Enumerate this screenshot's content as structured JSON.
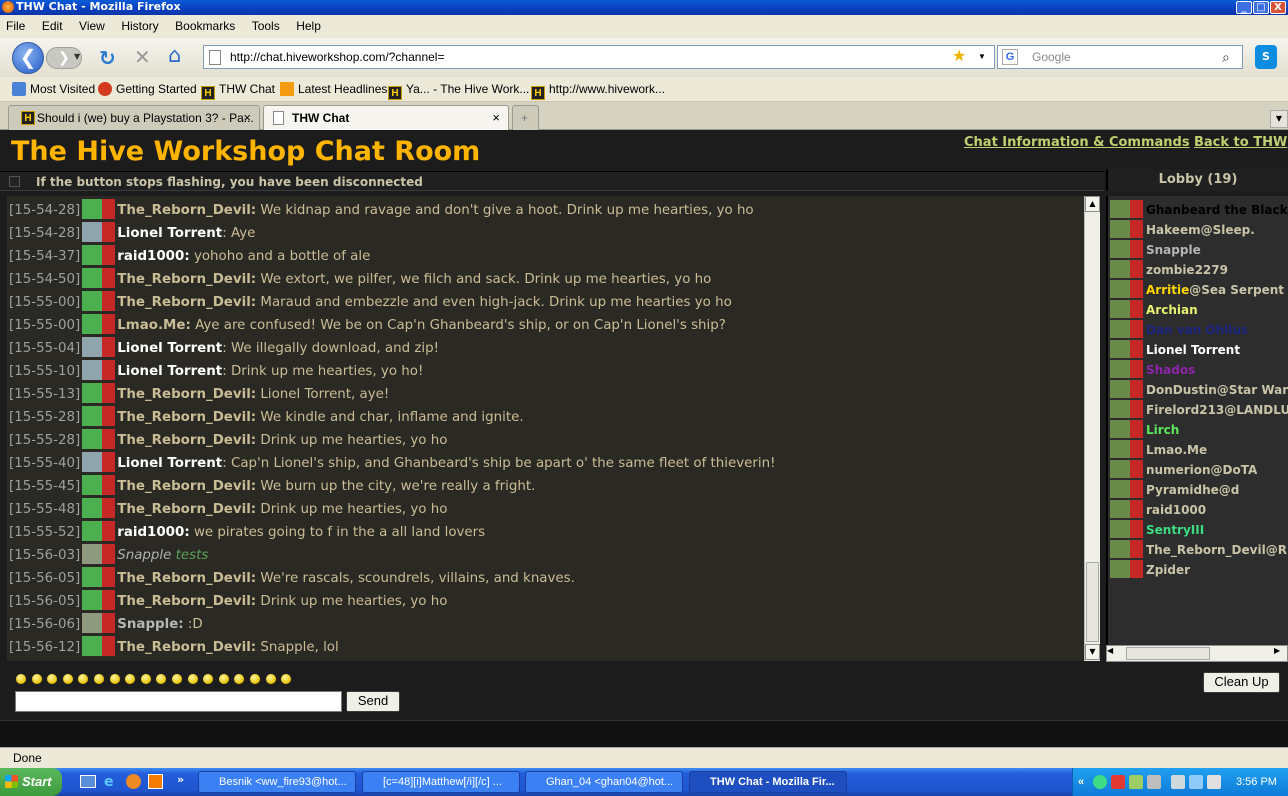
{
  "window": {
    "title": "THW Chat - Mozilla Firefox",
    "min": "_",
    "max": "□",
    "close": "X"
  },
  "menu": [
    "File",
    "Edit",
    "View",
    "History",
    "Bookmarks",
    "Tools",
    "Help"
  ],
  "nav": {
    "url": "http://chat.hiveworkshop.com/?channel=",
    "search_placeholder": "Google"
  },
  "bookmarks": [
    "Most Visited",
    "Getting Started",
    "THW Chat",
    "Latest Headlines",
    "Ya... - The Hive Work...",
    "http://www.hivework..."
  ],
  "tabs": [
    {
      "label": "Should i (we) buy a Playstation 3? - Pa...",
      "close": "×"
    },
    {
      "label": "THW Chat",
      "close": "×"
    }
  ],
  "page": {
    "title": "The Hive Workshop Chat Room",
    "link_info": "Chat Information & Commands",
    "link_back": "Back to THW",
    "disconnect_notice": "If the button stops flashing, you have been disconnected",
    "lobby_label": "Lobby (19)",
    "send_label": "Send",
    "cleanup_label": "Clean Up"
  },
  "messages": [
    {
      "time": "[15-54-28]",
      "name": "The_Reborn_Devil:",
      "text": " We kidnap and ravage and don't give a hoot. Drink up me hearties, yo ho",
      "color": "#c9bd96"
    },
    {
      "time": "[15-54-28]",
      "name": "Lionel Torrent",
      "text": ": Aye",
      "color": "#ffffff"
    },
    {
      "time": "[15-54-37]",
      "name": "raid1000:",
      "text": " yohoho and a bottle of ale",
      "color": "#c9bd96"
    },
    {
      "time": "[15-54-50]",
      "name": "The_Reborn_Devil:",
      "text": " We extort, we pilfer, we filch and sack. Drink up me hearties, yo ho",
      "color": "#c9bd96"
    },
    {
      "time": "[15-55-00]",
      "name": "The_Reborn_Devil:",
      "text": " Maraud and embezzle and even high-jack. Drink up me hearties yo ho",
      "color": "#c9bd96"
    },
    {
      "time": "[15-55-00]",
      "name": "Lmao.Me:",
      "text": " Aye are confused! We be on Cap'n Ghanbeard's ship, or on Cap'n Lionel's ship?",
      "color": "#c9bd96"
    },
    {
      "time": "[15-55-04]",
      "name": "Lionel Torrent",
      "text": ": We illegally download, and zip!",
      "color": "#ffffff"
    },
    {
      "time": "[15-55-10]",
      "name": "Lionel Torrent",
      "text": ": Drink up me hearties, yo ho!",
      "color": "#ffffff"
    },
    {
      "time": "[15-55-13]",
      "name": "The_Reborn_Devil:",
      "text": " Lionel Torrent, aye!",
      "color": "#c9bd96"
    },
    {
      "time": "[15-55-28]",
      "name": "The_Reborn_Devil:",
      "text": " We kindle and char, inflame and ignite.",
      "color": "#c9bd96"
    },
    {
      "time": "[15-55-28]",
      "name": "The_Reborn_Devil:",
      "text": " Drink up me hearties, yo ho",
      "color": "#c9bd96"
    },
    {
      "time": "[15-55-40]",
      "name": "Lionel Torrent",
      "text": ": Cap'n Lionel's ship, and Ghanbeard's ship be apart o' the same fleet of thieverin!",
      "color": "#ffffff"
    },
    {
      "time": "[15-55-45]",
      "name": "The_Reborn_Devil:",
      "text": " We burn up the city, we're really a fright.",
      "color": "#c9bd96"
    },
    {
      "time": "[15-55-48]",
      "name": "The_Reborn_Devil:",
      "text": " Drink up me hearties, yo ho",
      "color": "#c9bd96"
    },
    {
      "time": "[15-55-52]",
      "name": "raid1000:",
      "text": " we pirates going to f in the a all land lovers",
      "color": "#c9bd96"
    },
    {
      "time": "[15-56-03]",
      "name": "Snapple",
      "text": " tests",
      "color": "#b0b0b0",
      "action": true
    },
    {
      "time": "[15-56-05]",
      "name": "The_Reborn_Devil:",
      "text": " We're rascals, scoundrels, villains, and knaves.",
      "color": "#c9bd96"
    },
    {
      "time": "[15-56-05]",
      "name": "The_Reborn_Devil:",
      "text": " Drink up me hearties, yo ho",
      "color": "#c9bd96"
    },
    {
      "time": "[15-56-06]",
      "name": "Snapple:",
      "text": " :D",
      "color": "#b0b0b0"
    },
    {
      "time": "[15-56-12]",
      "name": "The_Reborn_Devil:",
      "text": " Snapple, lol",
      "color": "#c9bd96"
    }
  ],
  "lobby": [
    {
      "name": "Ghanbeard the Black",
      "suffix": "",
      "color": "#000000"
    },
    {
      "name": "Hakeem",
      "suffix": "@Sleep.",
      "color": "#c9c4a8"
    },
    {
      "name": "Snapple",
      "suffix": "",
      "color": "#b5b5b5"
    },
    {
      "name": "zombie2279",
      "suffix": "",
      "color": "#c9c4a8"
    },
    {
      "name": "Arritie",
      "suffix": "@Sea Serpent",
      "color": "#ffd700"
    },
    {
      "name": "Archian",
      "suffix": "",
      "color": "#e8f070"
    },
    {
      "name": "Dan van Ohllus",
      "suffix": "",
      "color": "#1a237e"
    },
    {
      "name": "Lionel Torrent",
      "suffix": "",
      "color": "#ffffff"
    },
    {
      "name": "Shados",
      "suffix": "",
      "color": "#8e24aa"
    },
    {
      "name": "DonDustin",
      "suffix": "@Star Wars",
      "color": "#c9c4a8"
    },
    {
      "name": "Firelord213",
      "suffix": "@LANDLU",
      "color": "#c9c4a8"
    },
    {
      "name": "Lirch",
      "suffix": "",
      "color": "#5ce65c"
    },
    {
      "name": "Lmao.Me",
      "suffix": "",
      "color": "#c9c4a8"
    },
    {
      "name": "numerion",
      "suffix": "@DoTA",
      "color": "#c9c4a8"
    },
    {
      "name": "Pyramidhe@d",
      "suffix": "",
      "color": "#c9c4a8"
    },
    {
      "name": "raid1000",
      "suffix": "",
      "color": "#c9c4a8"
    },
    {
      "name": "SentryIII",
      "suffix": "",
      "color": "#3ddc84"
    },
    {
      "name": "The_Reborn_Devil",
      "suffix": "@R",
      "color": "#c9c4a8"
    },
    {
      "name": "Zpider",
      "suffix": "",
      "color": "#c9c4a8"
    }
  ],
  "status": "Done",
  "taskbar": {
    "start": "Start",
    "tasks": [
      "Besnik <ww_fire93@hot...",
      "[c=48][i]Matthew[/i][/c] ...",
      "Ghan_04 <ghan04@hot...",
      "THW Chat - Mozilla Fir..."
    ],
    "clock": "3:56 PM"
  },
  "colors": {
    "accent": "#ffb400",
    "link": "#c0d070",
    "background": "#1c1c1c",
    "chat_bg": "#2b2923"
  }
}
